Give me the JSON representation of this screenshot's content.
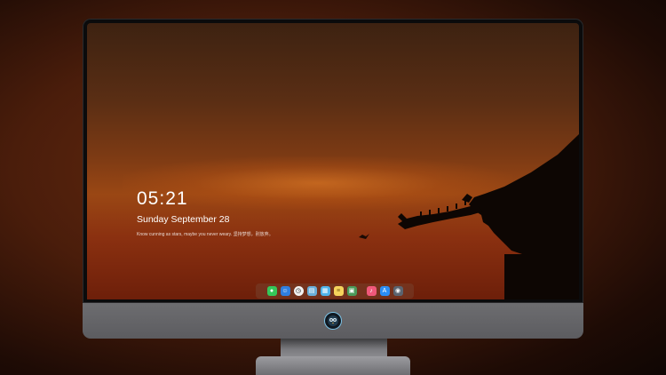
{
  "lockscreen": {
    "time": "05:21",
    "date": "Sunday September  28",
    "note": "Know cunning as stars, maybe you never weary. 坚持梦想，别放弃。"
  },
  "dock": {
    "icons": [
      {
        "name": "messages-icon",
        "color": "#34c759",
        "glyph": "●"
      },
      {
        "name": "finder-icon",
        "color": "#2f7ee0",
        "glyph": "☺"
      },
      {
        "name": "clock-icon",
        "color": "#f2f2f2",
        "glyph": "◷"
      },
      {
        "name": "preview-icon",
        "color": "#6aaed8",
        "glyph": "▤"
      },
      {
        "name": "claquette-icon",
        "color": "#4fb3e8",
        "glyph": "▦"
      },
      {
        "name": "notes-icon",
        "color": "#f5d35c",
        "glyph": "≡"
      },
      {
        "name": "photo-app-icon",
        "color": "#4b9a5a",
        "glyph": "▣"
      },
      {
        "name": "music-icon",
        "color": "#f0587a",
        "glyph": "♪"
      },
      {
        "name": "app-store-icon",
        "color": "#2a8df5",
        "glyph": "A"
      },
      {
        "name": "camera-icon",
        "color": "#5a6470",
        "glyph": "◉"
      }
    ]
  },
  "monitor": {
    "logo_icon": "owl-mascot-icon",
    "accent_color": "#7cc3e6"
  }
}
